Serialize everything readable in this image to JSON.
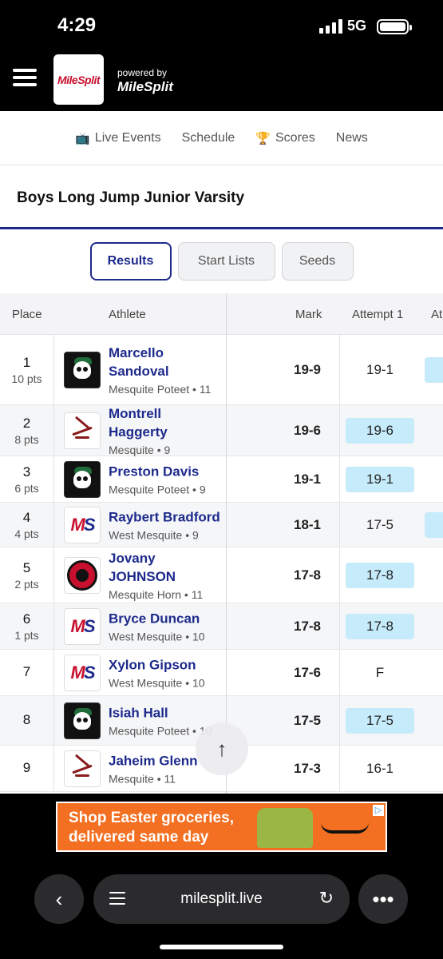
{
  "status": {
    "time": "4:29",
    "network": "5G",
    "signal_bars": 4,
    "battery_level": 1.0
  },
  "header": {
    "logo_text": "MileSplit",
    "powered_by": "powered by",
    "powered_brand": "MileSplit"
  },
  "nav": [
    {
      "label": "Live Events",
      "icon": "tv-icon"
    },
    {
      "label": "Schedule",
      "icon": ""
    },
    {
      "label": "Scores",
      "icon": "trophy-icon"
    },
    {
      "label": "News",
      "icon": ""
    }
  ],
  "event_title": "Boys Long Jump Junior Varsity",
  "tabs": [
    {
      "label": "Results",
      "active": true
    },
    {
      "label": "Start Lists",
      "active": false
    },
    {
      "label": "Seeds",
      "active": false
    }
  ],
  "table": {
    "headers": {
      "place": "Place",
      "athlete": "Athlete",
      "mark": "Mark",
      "attempt1": "Attempt 1",
      "attempt2_partial": "At"
    },
    "rows": [
      {
        "place": "1",
        "pts": "10 pts",
        "name": "Marcello Sandoval",
        "team": "Mesquite Poteet • 11",
        "logo": "poteet",
        "mark": "19-9",
        "attempt1": "19-1",
        "a1_hl": false,
        "a2_hl": true
      },
      {
        "place": "2",
        "pts": "8 pts",
        "name": "Montrell Haggerty",
        "team": "Mesquite • 9",
        "logo": "mesquite",
        "mark": "19-6",
        "attempt1": "19-6",
        "a1_hl": true,
        "a2_hl": false
      },
      {
        "place": "3",
        "pts": "6 pts",
        "name": "Preston Davis",
        "team": "Mesquite Poteet • 9",
        "logo": "poteet",
        "mark": "19-1",
        "attempt1": "19-1",
        "a1_hl": true,
        "a2_hl": false
      },
      {
        "place": "4",
        "pts": "4 pts",
        "name": "Raybert Bradford",
        "team": "West Mesquite • 9",
        "logo": "west-mesquite",
        "mark": "18-1",
        "attempt1": "17-5",
        "a1_hl": false,
        "a2_hl": true
      },
      {
        "place": "5",
        "pts": "2 pts",
        "name": "Jovany JOHNSON",
        "team": "Mesquite Horn • 11",
        "logo": "horn",
        "mark": "17-8",
        "attempt1": "17-8",
        "a1_hl": true,
        "a2_hl": false
      },
      {
        "place": "6",
        "pts": "1 pts",
        "name": "Bryce Duncan",
        "team": "West Mesquite • 10",
        "logo": "west-mesquite",
        "mark": "17-8",
        "attempt1": "17-8",
        "a1_hl": true,
        "a2_hl": false
      },
      {
        "place": "7",
        "pts": "",
        "name": "Xylon Gipson",
        "team": "West Mesquite • 10",
        "logo": "west-mesquite",
        "mark": "17-6",
        "attempt1": "F",
        "a1_hl": false,
        "a2_hl": false
      },
      {
        "place": "8",
        "pts": "",
        "name": "Isiah Hall",
        "team": "Mesquite Poteet • 10",
        "logo": "poteet",
        "mark": "17-5",
        "attempt1": "17-5",
        "a1_hl": true,
        "a2_hl": false
      },
      {
        "place": "9",
        "pts": "",
        "name": "Jaheim Glenn",
        "team": "Mesquite • 11",
        "logo": "mesquite",
        "mark": "17-3",
        "attempt1": "16-1",
        "a1_hl": false,
        "a2_hl": false
      }
    ]
  },
  "ad": {
    "line1": "Shop Easter groceries,",
    "line2": "delivered same day"
  },
  "browser": {
    "url": "milesplit.live"
  },
  "colors": {
    "brand_navy": "#1d2a8c",
    "highlight": "#c6ebfa",
    "ad_orange": "#f36f21"
  }
}
